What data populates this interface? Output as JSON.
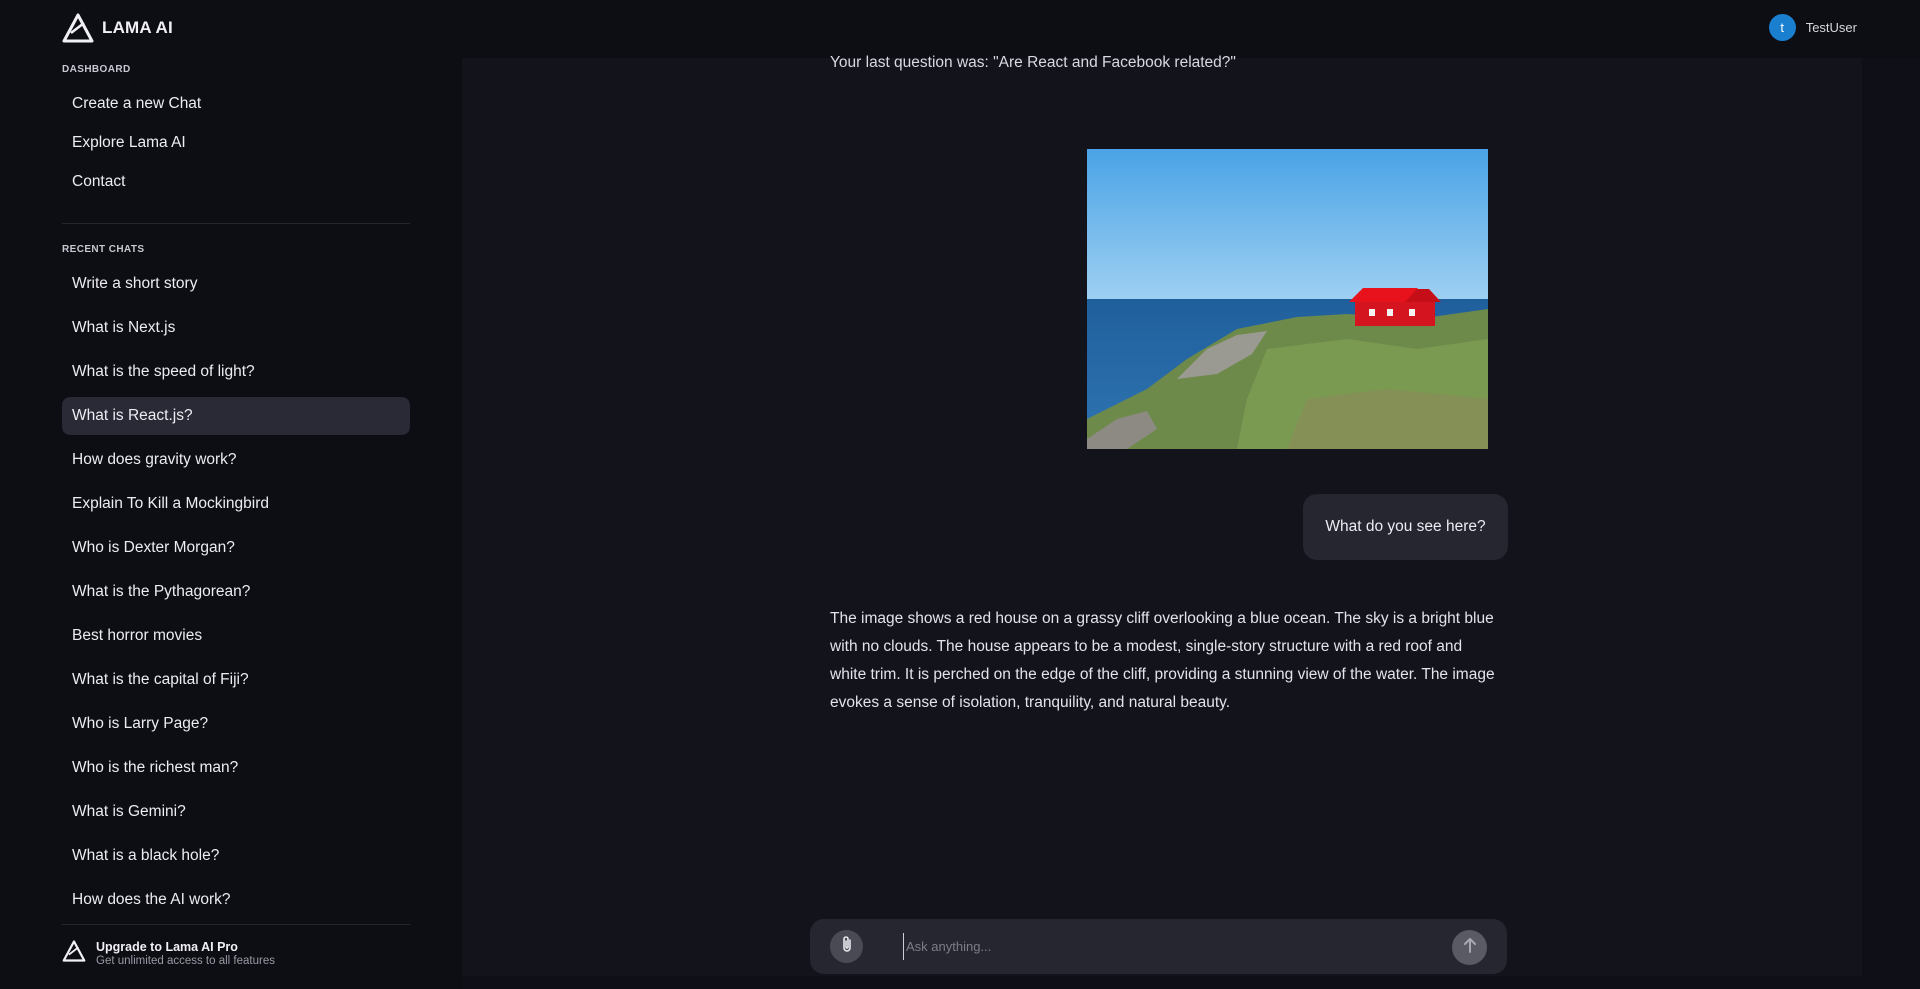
{
  "app": {
    "name": "LAMA AI",
    "logo_icon": "lama-ai-logo-icon"
  },
  "user": {
    "initial": "t",
    "name": "TestUser",
    "avatar_color": "#1b7fd0"
  },
  "sidebar": {
    "dashboard_label": "DASHBOARD",
    "dashboard_items": [
      {
        "label": "Create a new Chat"
      },
      {
        "label": "Explore Lama AI"
      },
      {
        "label": "Contact"
      }
    ],
    "recent_label": "RECENT CHATS",
    "recent_chats": [
      {
        "label": "Write a short story"
      },
      {
        "label": "What is Next.js"
      },
      {
        "label": "What is the speed of light?"
      },
      {
        "label": "What is React.js?",
        "active": true
      },
      {
        "label": "How does gravity work?"
      },
      {
        "label": "Explain To Kill a Mockingbird"
      },
      {
        "label": "Who is Dexter Morgan?"
      },
      {
        "label": "What is the Pythagorean?"
      },
      {
        "label": "Best horror movies"
      },
      {
        "label": "What is the capital of Fiji?"
      },
      {
        "label": "Who is Larry Page?"
      },
      {
        "label": "Who is the richest man?"
      },
      {
        "label": "What is Gemini?"
      },
      {
        "label": "What is a black hole?"
      },
      {
        "label": "How does the AI work?"
      }
    ],
    "upgrade": {
      "title": "Upgrade to Lama AI Pro",
      "subtitle": "Get unlimited access to all features"
    }
  },
  "chat": {
    "previous_message": "Your last question was: \"Are React and Facebook related?\"",
    "image_description_icon": "uploaded-image",
    "user_message": "What do you see here?",
    "ai_response": "The image shows a red house on a grassy cliff overlooking a blue ocean. The sky is a bright blue with no clouds. The house appears to be a modest, single-story structure with a red roof and white trim. It is perched on the edge of the cliff, providing a stunning view of the water. The image evokes a sense of isolation, tranquility, and natural beauty."
  },
  "composer": {
    "placeholder": "Ask anything...",
    "value": "",
    "attach_icon": "paperclip-icon",
    "send_icon": "arrow-up-icon"
  },
  "colors": {
    "background": "#0d0d14",
    "main_background": "#13131c",
    "active_item": "#2a2a36",
    "bubble": "#262631"
  }
}
